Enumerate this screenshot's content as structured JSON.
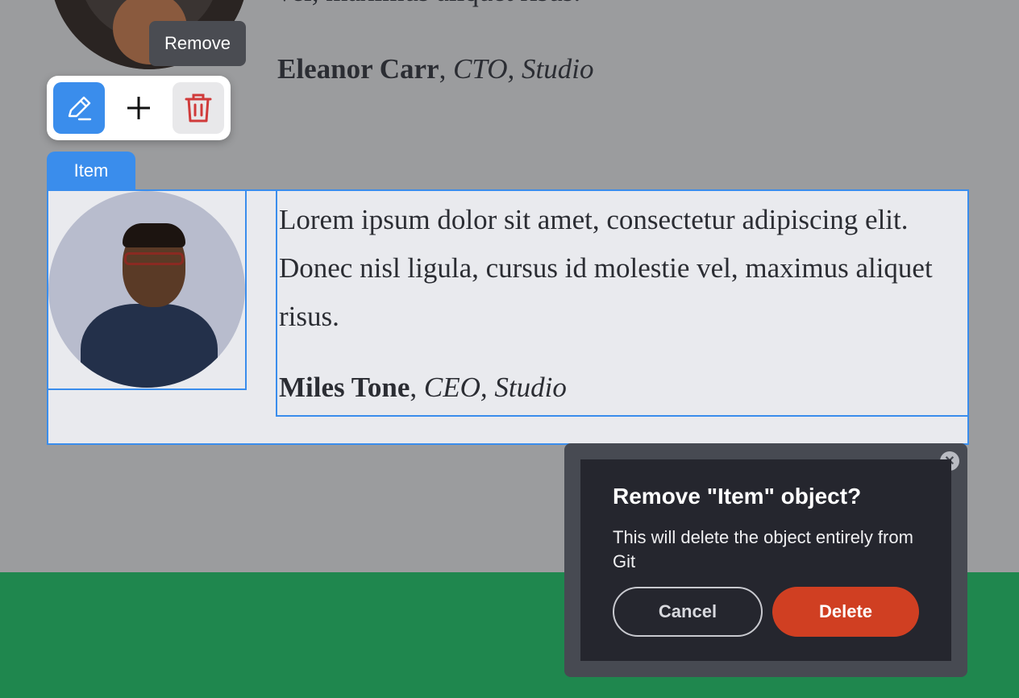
{
  "previous_item": {
    "quote_tail": "vel, maximus aliquet risus.",
    "author_name": "Eleanor Carr",
    "author_role": "CTO",
    "author_company": "Studio"
  },
  "tooltip": {
    "text": "Remove"
  },
  "toolbar": {
    "edit_icon": "pencil-icon",
    "add_icon": "plus-icon",
    "delete_icon": "trash-icon"
  },
  "item_label": "Item",
  "item": {
    "quote": "Lorem ipsum dolor sit amet, consectetur adipiscing elit. Donec nisl ligula, cursus id molestie vel, maximus aliquet risus.",
    "author_name": "Miles Tone",
    "author_role": "CEO",
    "author_company": "Studio"
  },
  "dialog": {
    "title": "Remove \"Item\" object?",
    "message": "This will delete the object entirely from Git",
    "cancel_label": "Cancel",
    "delete_label": "Delete",
    "close_icon": "close-icon"
  },
  "colors": {
    "accent": "#3a8dec",
    "danger": "#d03f22",
    "footer": "#1f874e",
    "overlay": "#9b9c9e"
  }
}
